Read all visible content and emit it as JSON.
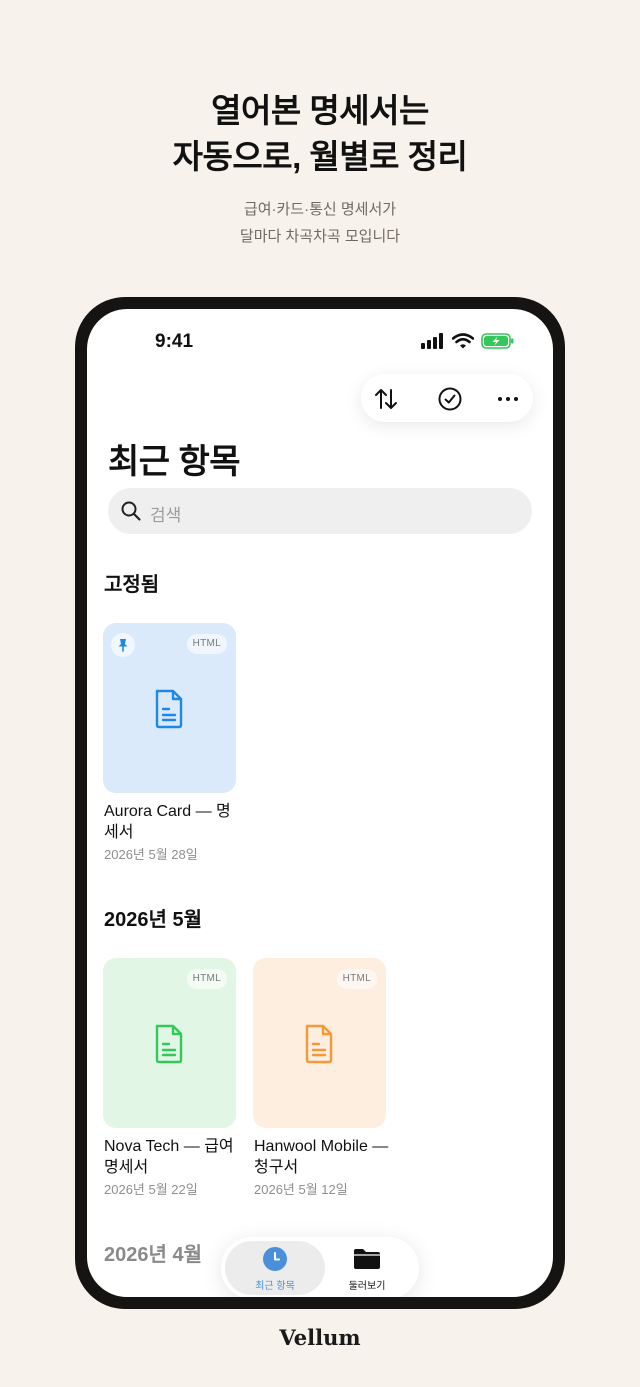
{
  "promo": {
    "headline_line1": "열어본 명세서는",
    "headline_line2": "자동으로, 월별로 정리",
    "sub_line1": "급여·카드·통신 명세서가",
    "sub_line2": "달마다 차곡차곡 모입니다",
    "brand": "Vellum"
  },
  "status_bar": {
    "time": "9:41"
  },
  "toolbar": {
    "icons": [
      "sort-icon",
      "check-circle-icon",
      "more-icon"
    ]
  },
  "page": {
    "title": "최근 항목",
    "search_placeholder": "검색"
  },
  "sections": {
    "pinned": {
      "title": "고정됨",
      "items": [
        {
          "title": "Aurora Card — 명세서",
          "date": "2026년 5월 28일",
          "badge": "HTML",
          "color": "#dbeafb",
          "icon_color": "#1e88e5"
        }
      ]
    },
    "may": {
      "title": "2026년 5월",
      "items": [
        {
          "title": "Nova Tech — 급여 명세서",
          "date": "2026년 5월 22일",
          "badge": "HTML",
          "color": "#e2f6e6",
          "icon_color": "#34c759"
        },
        {
          "title": "Hanwool Mobile — 청구서",
          "date": "2026년 5월 12일",
          "badge": "HTML",
          "color": "#fdeee0",
          "icon_color": "#f29a3a"
        }
      ]
    },
    "april": {
      "title": "2026년 4월"
    }
  },
  "tabbar": {
    "recent_label": "최근 항목",
    "browse_label": "둘러보기",
    "accent": "#4a8fd9"
  }
}
